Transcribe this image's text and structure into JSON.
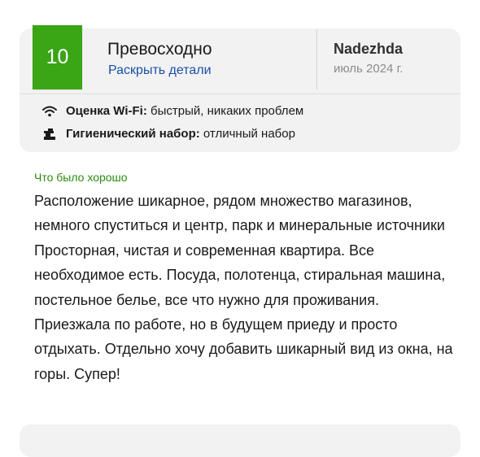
{
  "review": {
    "score": "10",
    "rating_word": "Превосходно",
    "details_link": "Раскрыть детали",
    "author": "Nadezhda",
    "date": "июль 2024 г.",
    "facts": [
      {
        "icon": "wifi-icon",
        "label": "Оценка Wi-Fi:",
        "value": "быстрый, никаких проблем"
      },
      {
        "icon": "toiletries-icon",
        "label": "Гигиенический набор:",
        "value": "отличный набор"
      }
    ],
    "good_label": "Что было хорошо",
    "good_text": "Расположение шикарное, рядом множество магазинов, немного спуститься и центр, парк и минеральные источники\nПросторная, чистая и современная квартира. Все необходимое есть. Посуда, полотенца, стиральная машина, постельное белье, все что нужно для проживания. Приезжала по работе, но в будущем приеду и просто отдыхать. Отдельно хочу добавить шикарный вид из окна, на горы. Супер!"
  },
  "colors": {
    "score_badge": "#3aa515",
    "link": "#1a4fa8",
    "good_label": "#2b8a0e",
    "card_bg": "#f2f2f2"
  }
}
